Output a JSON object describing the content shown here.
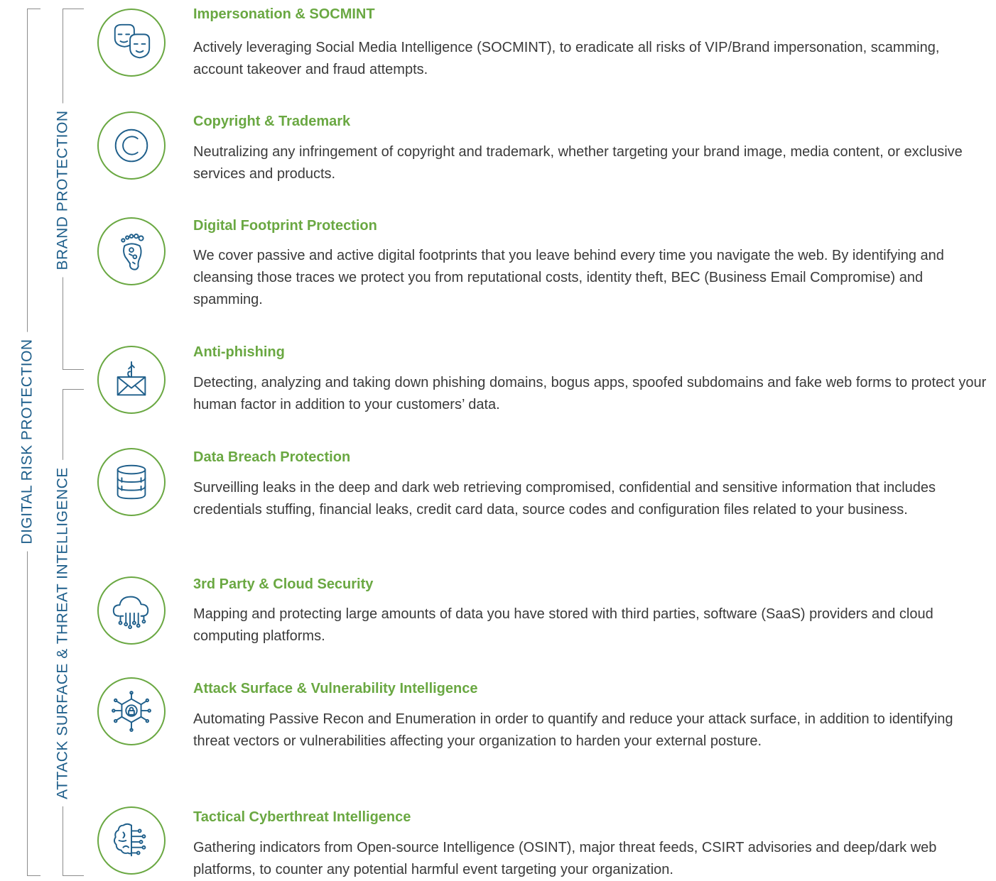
{
  "groups": {
    "outer": "DIGITAL RISK PROTECTION",
    "brand": "BRAND PROTECTION",
    "attack": "ATTACK SURFACE & THREAT INTELLIGENCE"
  },
  "items": [
    {
      "title": "Impersonation & SOCMINT",
      "description": "Actively leveraging Social Media Intelligence (SOCMINT), to eradicate all risks of VIP/Brand impersonation, scamming, account takeover and fraud attempts.",
      "icon": "masks-icon"
    },
    {
      "title": "Copyright & Trademark",
      "description": "Neutralizing any infringement of copyright and trademark, whether targeting your brand image, media content, or exclusive services and products.",
      "icon": "copyright-icon"
    },
    {
      "title": "Digital Footprint Protection",
      "description": "We cover passive and active digital footprints that you leave behind every time you navigate the web. By identifying and cleansing those traces we protect you from reputational costs, identity theft, BEC (Business Email Compromise) and spamming.",
      "icon": "footprint-icon"
    },
    {
      "title": "Anti-phishing",
      "description": "Detecting, analyzing and taking down phishing domains, bogus apps, spoofed subdomains and fake web forms to protect your human factor in addition to your customers’ data.",
      "icon": "phishing-envelope-icon"
    },
    {
      "title": "Data Breach Protection",
      "description": "Surveilling leaks in the deep and dark web retrieving compromised, confidential and sensitive information that includes credentials stuffing, financial leaks, credit card data, source codes and configuration files related to your business.",
      "icon": "database-icon"
    },
    {
      "title": "3rd Party & Cloud Security",
      "description": "Mapping and protecting large amounts of data you have stored with third parties, software (SaaS) providers and cloud computing platforms.",
      "icon": "cloud-network-icon"
    },
    {
      "title": "Attack Surface & Vulnerability Intelligence",
      "description": "Automating Passive Recon and Enumeration in order to quantify and reduce your attack surface, in addition to identifying threat vectors or vulnerabilities affecting your organization to harden your external posture.",
      "icon": "lock-chip-icon"
    },
    {
      "title": "Tactical Cyberthreat Intelligence",
      "description": "Gathering indicators from Open-source Intelligence (OSINT), major threat feeds, CSIRT advisories and deep/dark web platforms, to counter any potential harmful event targeting your organization.",
      "icon": "brain-circuit-icon"
    }
  ],
  "colors": {
    "accent": "#6aa842",
    "label": "#1f5f8b",
    "body_text": "#3a3a3a",
    "icon_stroke": "#1f5f8b",
    "bracket": "#8c8c8c"
  }
}
